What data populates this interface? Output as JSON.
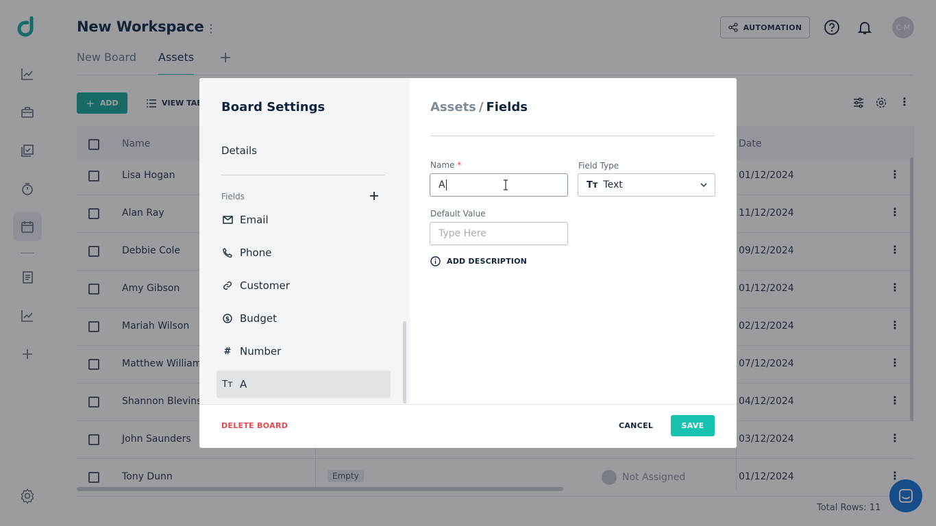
{
  "workspace": {
    "title": "New Workspace"
  },
  "tabs": [
    {
      "label": "New Board",
      "active": false
    },
    {
      "label": "Assets",
      "active": true
    }
  ],
  "header": {
    "automation_label": "AUTOMATION",
    "avatar_initials": "C M"
  },
  "toolbar": {
    "add_label": "ADD",
    "view_label": "VIEW TAB"
  },
  "table": {
    "columns": {
      "name": "Name",
      "date": "Date"
    },
    "rows": [
      {
        "name": "Lisa Hogan",
        "date": "01/12/2024"
      },
      {
        "name": "Alan Ray",
        "date": "11/12/2024"
      },
      {
        "name": "Debbie Cole",
        "date": "09/12/2024"
      },
      {
        "name": "Amy Gibson",
        "date": "01/12/2024"
      },
      {
        "name": "Mariah Wilson",
        "date": "02/12/2024"
      },
      {
        "name": "Matthew Williams",
        "date": "07/12/2024"
      },
      {
        "name": "Shannon Blevins",
        "date": "04/12/2024"
      },
      {
        "name": "John Saunders",
        "date": "03/12/2024"
      },
      {
        "name": "Tony Dunn",
        "date": "01/12/2024",
        "status": "Empty",
        "assignee": "Not Assigned"
      }
    ],
    "total_rows": "Total Rows: 11"
  },
  "modal": {
    "heading": "Board Settings",
    "nav_details": "Details",
    "fields_label": "Fields",
    "fields": [
      {
        "label": "Email",
        "icon": "mail-icon"
      },
      {
        "label": "Phone",
        "icon": "phone-icon"
      },
      {
        "label": "Customer",
        "icon": "link-icon"
      },
      {
        "label": "Budget",
        "icon": "dollar-icon"
      },
      {
        "label": "Number",
        "icon": "hash-icon"
      },
      {
        "label": "A",
        "icon": "text-type-icon",
        "selected": true
      }
    ],
    "breadcrumb": {
      "parent": "Assets",
      "sep": "/",
      "current": "Fields"
    },
    "form": {
      "name_label": "Name",
      "required_mark": "*",
      "name_value": "A",
      "field_type_label": "Field Type",
      "field_type_value": "Text",
      "field_type_icon": "Tт",
      "default_value_label": "Default Value",
      "default_value_placeholder": "Type Here",
      "add_description_label": "ADD DESCRIPTION"
    },
    "footer": {
      "delete_label": "DELETE BOARD",
      "cancel_label": "CANCEL",
      "save_label": "SAVE"
    }
  },
  "colors": {
    "accent": "#13a596",
    "save": "#17c2b1",
    "danger": "#e5484d",
    "brand": "#13a596"
  }
}
